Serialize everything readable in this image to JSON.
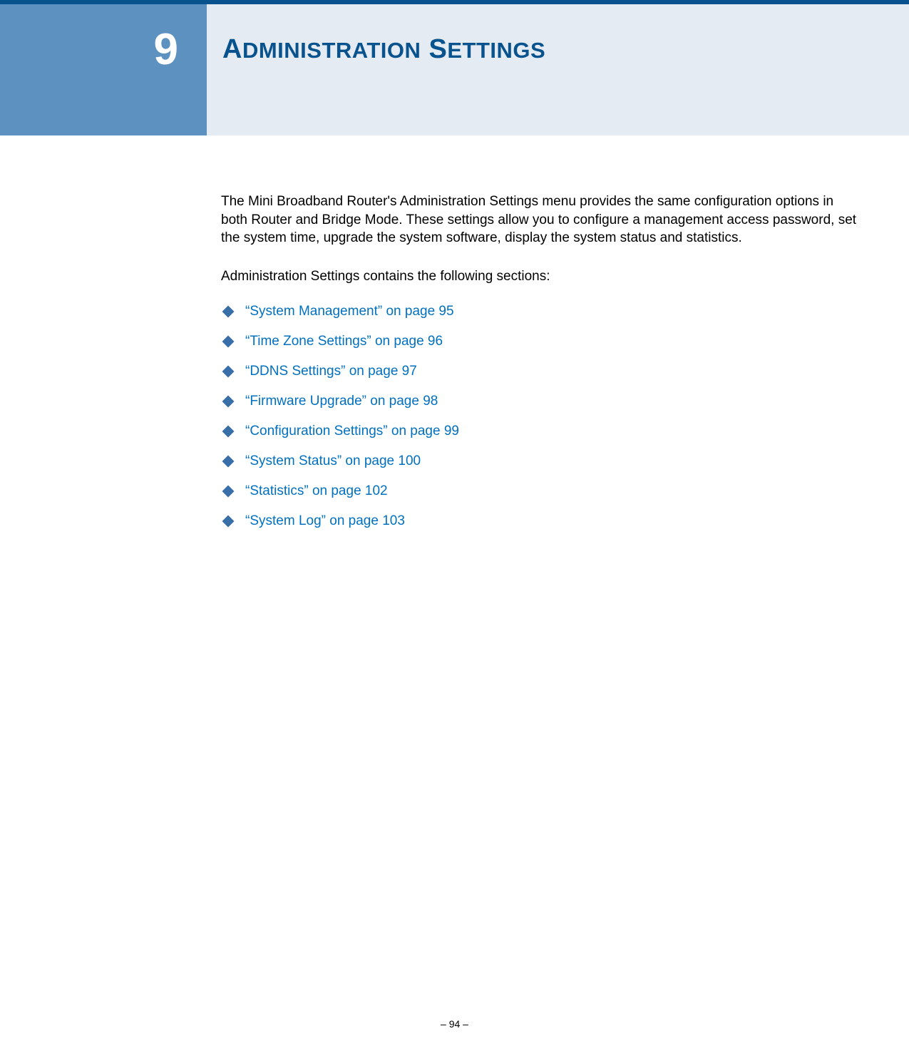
{
  "header": {
    "chapter_number": "9",
    "title_word1_first": "A",
    "title_word1_rest": "DMINISTRATION",
    "title_word2_first": "S",
    "title_word2_rest": "ETTINGS"
  },
  "intro": "The Mini Broadband Router's Administration Settings menu provides the same configuration options in both Router and Bridge Mode. These settings allow you to configure a management access password, set the system time, upgrade the system software, display the system status and statistics.",
  "subheading": "Administration Settings contains the following sections:",
  "toc": [
    {
      "label": "“System Management” on page 95"
    },
    {
      "label": "“Time Zone Settings” on page 96"
    },
    {
      "label": "“DDNS Settings” on page 97"
    },
    {
      "label": "“Firmware Upgrade” on page 98"
    },
    {
      "label": "“Configuration Settings” on page 99"
    },
    {
      "label": "“System Status” on page 100"
    },
    {
      "label": "“Statistics” on page 102"
    },
    {
      "label": "“System Log” on page 103"
    }
  ],
  "footer": "–  94  –"
}
